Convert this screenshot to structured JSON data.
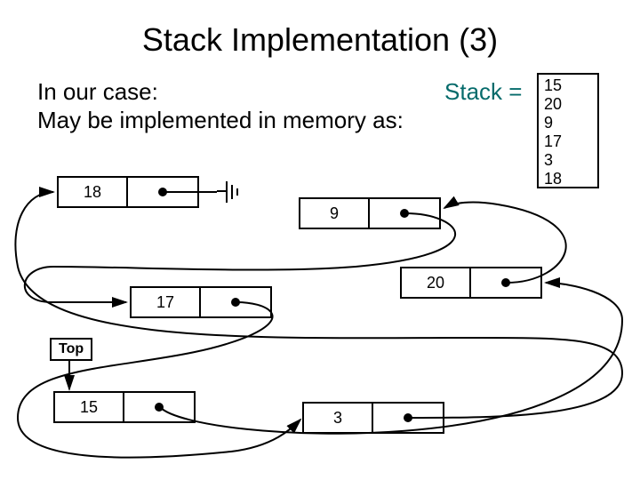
{
  "title": "Stack Implementation (3)",
  "intro_line1": "In our case:",
  "intro_line2": "May be implemented in memory as:",
  "stack_label": "Stack =",
  "stack_values": [
    "15",
    "20",
    "9",
    "17",
    "3",
    "18"
  ],
  "top_label": "Top",
  "nodes": {
    "n18": "18",
    "n9": "9",
    "n17": "17",
    "n20": "20",
    "n15": "15",
    "n3": "3"
  }
}
